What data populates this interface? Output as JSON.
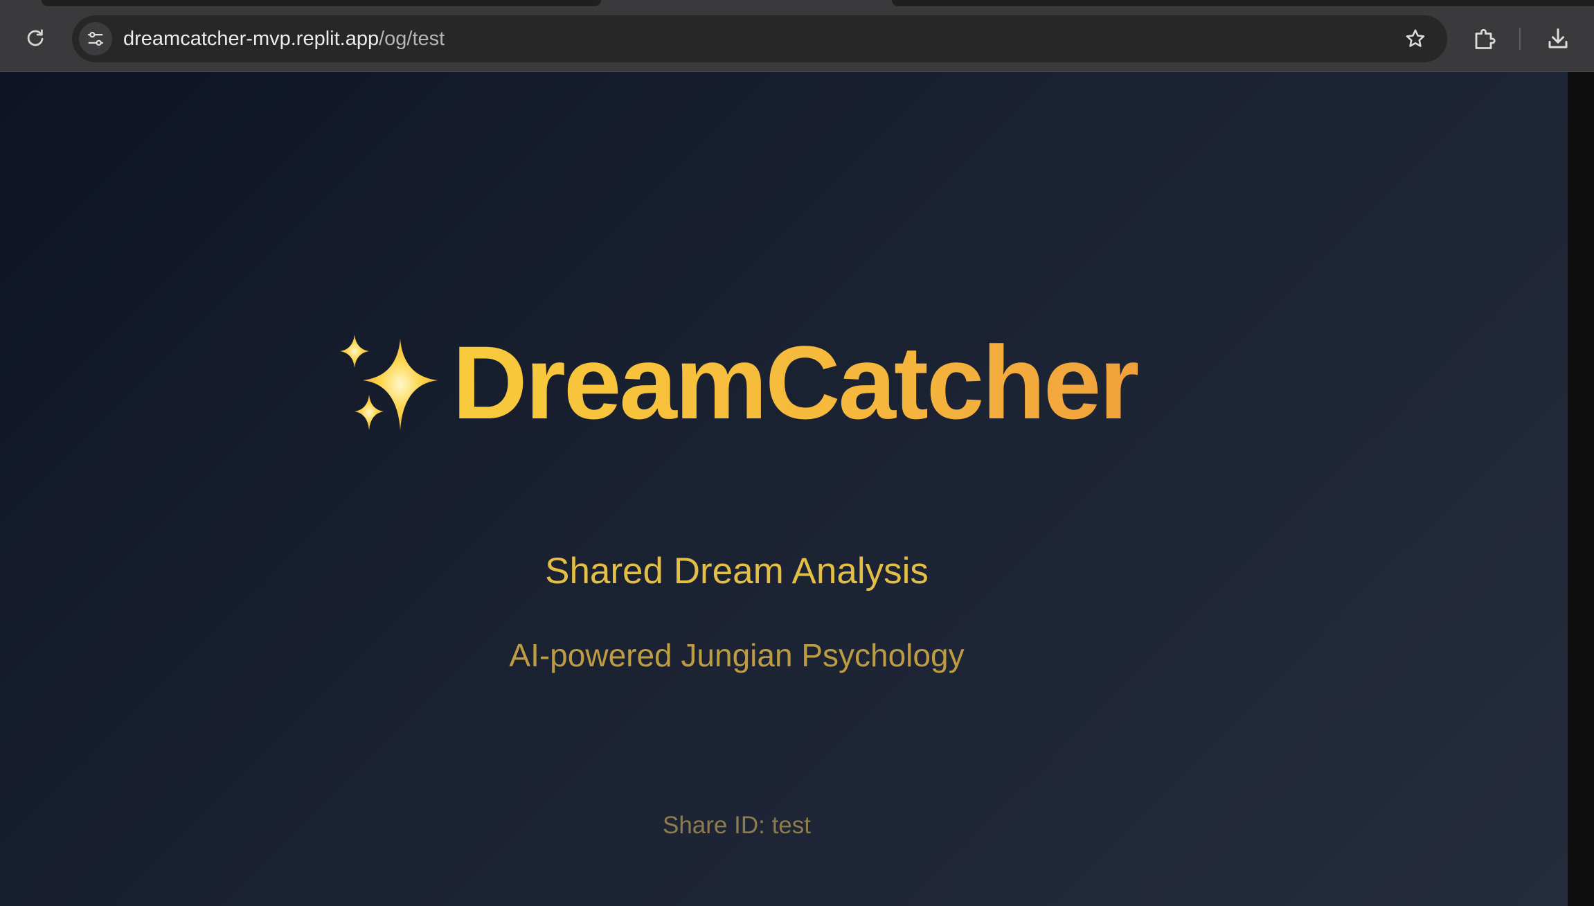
{
  "browser": {
    "url_host": "dreamcatcher-mvp.replit.app",
    "url_path": "/og/test",
    "icons": {
      "reload": "reload-icon",
      "site_info": "tune-icon",
      "bookmark": "star-icon",
      "extensions": "puzzle-piece-icon",
      "downloads": "download-icon"
    }
  },
  "page": {
    "brand_emoji": "sparkles-icon",
    "title": "DreamCatcher",
    "subtitle": "Shared Dream Analysis",
    "tagline": "AI-powered Jungian Psychology",
    "share_id": "Share ID: test"
  },
  "colors": {
    "background_start": "#0e1424",
    "background_end": "#252c3d",
    "title_gradient_start": "#f8cb3c",
    "title_gradient_end": "#f1a13c",
    "subtitle": "#e3bf46",
    "tagline": "#bd9c42",
    "share_id": "#8c7c4f"
  }
}
